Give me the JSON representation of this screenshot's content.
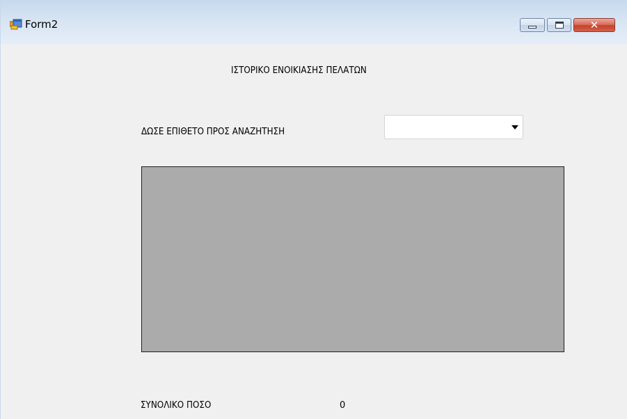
{
  "window": {
    "title": "Form2",
    "icon": "winforms-app-icon",
    "controls": {
      "minimize": "minimize-icon",
      "maximize": "maximize-icon",
      "close_label": "✕"
    }
  },
  "form": {
    "title": "ΙΣΤΟΡΙΚΟ ΕΝΟΙΚΙΑΣΗΣ ΠΕΛΑΤΩΝ",
    "search_label": "ΔΩΣΕ ΕΠΙΘΕΤΟ ΠΡΟΣ ΑΝΑΖΗΤΗΣΗ",
    "surname_combo": {
      "selected": ""
    },
    "total_label": "ΣΥΝΟΛΙΚΟ ΠΟΣΟ",
    "total_value": "0"
  },
  "colors": {
    "grid_background": "#ababab",
    "form_background": "#f0f0f0"
  }
}
